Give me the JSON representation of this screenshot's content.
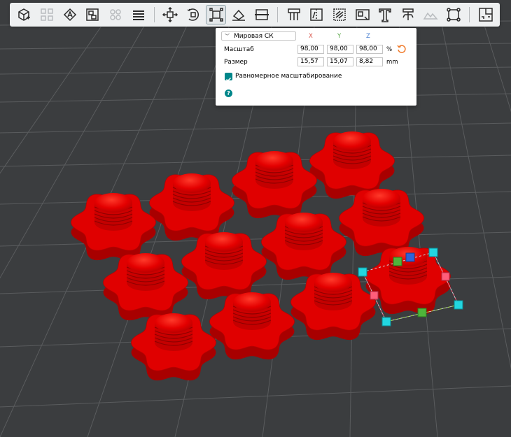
{
  "toolbar": {
    "tools": [
      {
        "name": "add-object-icon",
        "state": "normal"
      },
      {
        "name": "arrange-grid-icon",
        "state": "muted"
      },
      {
        "name": "auto-orient-icon",
        "state": "normal"
      },
      {
        "name": "split-objects-icon",
        "state": "normal"
      },
      {
        "name": "split-parts-icon",
        "state": "muted"
      },
      {
        "name": "layer-editing-icon",
        "state": "normal"
      },
      {
        "name": "move-icon",
        "state": "normal"
      },
      {
        "name": "rotate-icon",
        "state": "normal"
      },
      {
        "name": "scale-icon",
        "state": "active"
      },
      {
        "name": "lay-on-face-icon",
        "state": "normal"
      },
      {
        "name": "cut-icon",
        "state": "normal"
      },
      {
        "name": "support-paint-icon",
        "state": "normal"
      },
      {
        "name": "seam-paint-icon",
        "state": "normal"
      },
      {
        "name": "fuzzy-skin-icon",
        "state": "normal"
      },
      {
        "name": "measure-icon",
        "state": "normal"
      },
      {
        "name": "text-icon",
        "state": "normal"
      },
      {
        "name": "brim-ears-icon",
        "state": "normal"
      },
      {
        "name": "mesh-boolean-icon",
        "state": "muted"
      },
      {
        "name": "simplify-icon",
        "state": "normal"
      },
      {
        "name": "assembly-icon",
        "state": "normal"
      }
    ]
  },
  "scale_panel": {
    "coord_system": "Мировая СК",
    "axes": {
      "x": "X",
      "y": "Y",
      "z": "Z"
    },
    "scale_label": "Масштаб",
    "scale": {
      "x": "98,00",
      "y": "98,00",
      "z": "98,00"
    },
    "scale_unit": "%",
    "size_label": "Размер",
    "size": {
      "x": "15,57",
      "y": "15,07",
      "z": "8,82"
    },
    "size_unit": "mm",
    "uniform_scaling_label": "Равномерное масштабирование",
    "uniform_scaling_checked": true,
    "help_glyph": "?"
  },
  "colors": {
    "bed_background": "#3b3d3f",
    "grid_line": "#5a5c5e",
    "model_red": "#e00000",
    "accent": "#00868a",
    "axis_x": "#d9564d",
    "axis_y": "#5ba84a",
    "axis_z": "#4a7fd0"
  },
  "scene": {
    "object_count": 13,
    "selected_object_index": 12
  }
}
